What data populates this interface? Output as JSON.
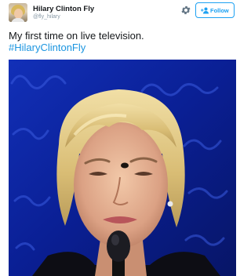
{
  "user": {
    "name": "Hilary Clinton Fly",
    "handle": "@fly_hilary"
  },
  "actions": {
    "follow_label": "Follow"
  },
  "tweet": {
    "text": "My first time on live television.",
    "hashtag": "#HilaryClintonFly"
  },
  "icons": {
    "settings": "gear-icon",
    "follow": "add-user-icon"
  },
  "colors": {
    "accent": "#1da1f2",
    "link": "#1b95e0",
    "backdrop_blue": "#0b1f8c"
  }
}
